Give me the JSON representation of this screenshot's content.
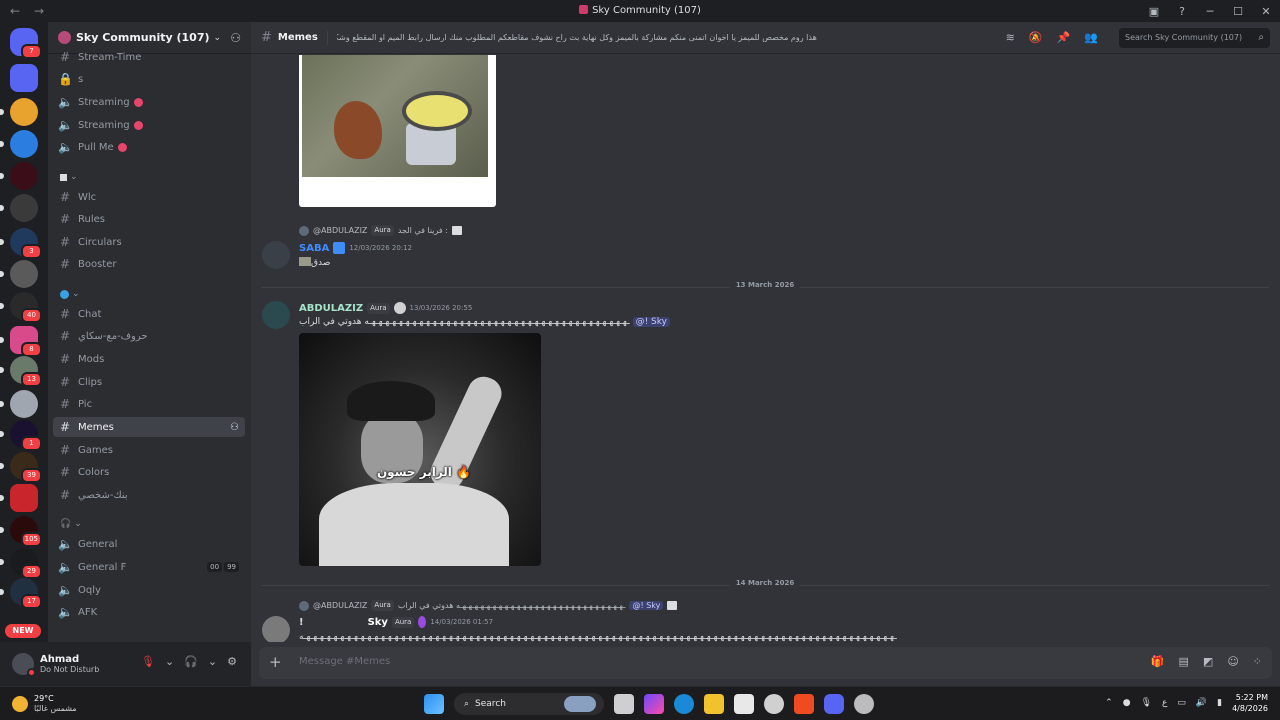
{
  "window": {
    "title": "Sky Community (107)",
    "back": "←",
    "forward": "→"
  },
  "server": {
    "name": "Sky Community (107)"
  },
  "guild_badges": [
    "7",
    "3",
    "40",
    "8",
    "13",
    "1",
    "39",
    "105",
    "29",
    "17"
  ],
  "new_label": "NEW",
  "channels": [
    {
      "name": "Stream-Time",
      "icon": "hash",
      "kind": "text"
    },
    {
      "name": "s",
      "icon": "lock",
      "kind": "text"
    },
    {
      "name": "Streaming",
      "icon": "speaker",
      "kind": "voice",
      "live": true
    },
    {
      "name": "Streaming",
      "icon": "speaker",
      "kind": "voice",
      "live": true
    },
    {
      "name": "Pull Me",
      "icon": "speaker",
      "kind": "voice",
      "live": true
    },
    {
      "name": "Wlc",
      "icon": "hash",
      "kind": "text"
    },
    {
      "name": "Rules",
      "icon": "hash",
      "kind": "text"
    },
    {
      "name": "Circulars",
      "icon": "hash",
      "kind": "text"
    },
    {
      "name": "Booster",
      "icon": "hash",
      "kind": "text"
    },
    {
      "name": "Chat",
      "icon": "hash",
      "kind": "text"
    },
    {
      "name": "حروف-مع-سكاي",
      "icon": "hash",
      "kind": "text"
    },
    {
      "name": "Mods",
      "icon": "hash",
      "kind": "text"
    },
    {
      "name": "Clips",
      "icon": "hash",
      "kind": "text"
    },
    {
      "name": "Pic",
      "icon": "hash",
      "kind": "text"
    },
    {
      "name": "Memes",
      "icon": "hash",
      "kind": "text",
      "active": true
    },
    {
      "name": "Games",
      "icon": "hash",
      "kind": "text"
    },
    {
      "name": "Colors",
      "icon": "hash",
      "kind": "text"
    },
    {
      "name": "بنك-شخصي",
      "icon": "hash",
      "kind": "text"
    },
    {
      "name": "General",
      "icon": "speaker",
      "kind": "voice"
    },
    {
      "name": "General F",
      "icon": "speaker",
      "kind": "voice",
      "counts": [
        "00",
        "99"
      ]
    },
    {
      "name": "Oqly",
      "icon": "speaker",
      "kind": "voice"
    },
    {
      "name": "AFK",
      "icon": "speaker",
      "kind": "voice"
    }
  ],
  "user": {
    "name": "Ahmad",
    "status": "Do Not Disturb"
  },
  "channel_header": {
    "name": "Memes",
    "topic": "هذا روم مخصص للميمز يا اخوان اتمنى منكم مشاركة بالميمز وكل نهاية بث راح نشوف مقاطعكم المطلوب منك ارسال رابط الميم او المقطع وشكرا لكم",
    "search_placeholder": "Search Sky Community (107)"
  },
  "messages": [
    {
      "reply_to": {
        "name": "@ABDULAZIZ",
        "tag": "Aura",
        "text": "فرينا في الجد :"
      },
      "author": "SABA",
      "author_color": "#3f8cff",
      "timestamp": "12/03/2026 20:12",
      "text": "صدق"
    },
    {
      "divider": "13 March 2026",
      "author": "ABDULAZIZ",
      "author_color": "#a6e3c9",
      "tag": "Aura",
      "timestamp": "13/03/2026 20:55",
      "text_prefix": "ـهـهـهـهـهـهـهـهـهـهـهـهـهـهـهـهـهـهـهـهـهـهـهـهـهـهـهـهـهـهـهـهـهـهـهـهـهـهـه هدوتي في الراب",
      "mention": "@!              Sky",
      "image_caption": "الرابر حسون 🔥"
    },
    {
      "divider": "14 March 2026",
      "reply_to": {
        "name": "@ABDULAZIZ",
        "tag": "Aura",
        "text": "ـهـهـهـهـهـهـهـهـهـهـهـهـهـهـهـهـهـهـهـهـهـهـهـهـهـهـهـه هدوتي في الراب",
        "mention": "@!              Sky"
      },
      "author": "Sky",
      "author_color": "#ffffff",
      "prefix": "!",
      "tag": "Aura",
      "timestamp": "14/03/2026 01:57",
      "text": "ـهـهـهـهـهـهـهـهـهـهـهـهـهـهـهـهـهـهـهـهـهـهـهـهـهـهـهـهـهـهـهـهـهـهـهـهـهـهـهـهـهـهـهـهـهـهـهـهـهـهـهـهـهـهـهـهـهـهـهـهـهـهـهـهـهـهـهـهـهـهـهـهـهـهـهـهـهـهـهـهـهـهـهـهـهـهـهـه"
    }
  ],
  "composer": {
    "placeholder": "Message #Memes"
  },
  "taskbar": {
    "temp": "29°C",
    "condition": "مشمس غالبًا",
    "search": "Search",
    "time": "5:22 PM",
    "date": "4/8/2026",
    "lang": "ع"
  }
}
